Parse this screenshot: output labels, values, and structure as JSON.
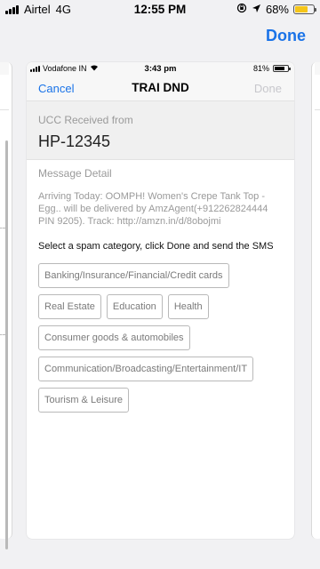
{
  "outer_status": {
    "carrier": "Airtel",
    "network": "4G",
    "time": "12:55 PM",
    "battery": "68%",
    "battery_color": "#f5c518"
  },
  "outer_nav": {
    "done_label": "Done"
  },
  "card_status": {
    "carrier": "Vodafone IN",
    "time": "3:43 pm",
    "battery": "81%"
  },
  "nav": {
    "cancel_label": "Cancel",
    "title": "TRAI DND",
    "done_label": "Done"
  },
  "ucc": {
    "label": "UCC Received from",
    "value": "HP-12345"
  },
  "message": {
    "label": "Message Detail",
    "body": "Arriving Today: OOMPH! Women's Crepe Tank Top - Egg.. will be delivered by AmzAgent(+912262824444 PIN 9205). Track: http://amzn.in/d/8obojmi"
  },
  "prompt": "Select a spam category, click Done and send the SMS",
  "categories": [
    "Banking/Insurance/Financial/Credit cards",
    "Real Estate",
    "Education",
    "Health",
    "Consumer goods & automobiles",
    "Communication/Broadcasting/Entertainment/IT",
    "Tourism & Leisure"
  ],
  "colors": {
    "accent": "#1a73e8",
    "disabled": "#c7c7cc"
  },
  "icons": [
    "location-arrow-icon",
    "rotation-lock-icon",
    "wifi-icon",
    "signal-icon",
    "battery-icon"
  ]
}
